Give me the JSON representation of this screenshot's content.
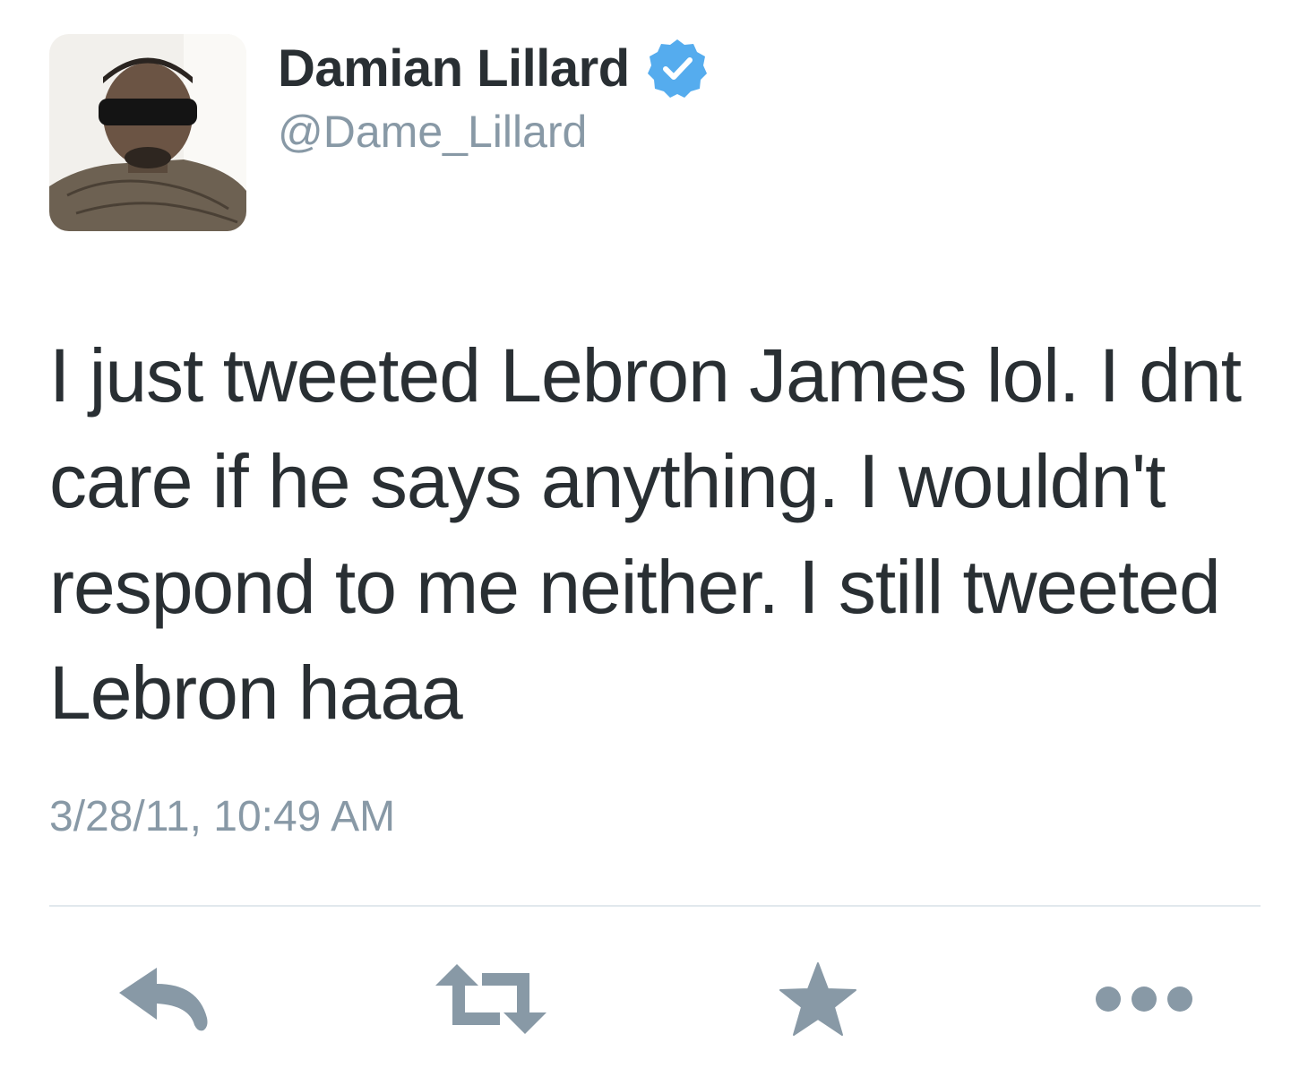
{
  "tweet": {
    "display_name": "Damian Lillard",
    "handle": "@Dame_Lillard",
    "verified": true,
    "text": "I just tweeted Lebron James lol. I dnt care if he says anything. I wouldn't respond to me neither. I still tweeted Lebron haaa",
    "timestamp": "3/28/11, 10:49 AM"
  },
  "actions": [
    {
      "name": "reply",
      "icon": "reply-icon"
    },
    {
      "name": "retweet",
      "icon": "retweet-icon"
    },
    {
      "name": "favorite",
      "icon": "star-icon"
    },
    {
      "name": "more",
      "icon": "more-dots-icon"
    }
  ],
  "colors": {
    "text": "#292f33",
    "secondary": "#8899a6",
    "verified_badge": "#55acee",
    "divider": "#e1e8ed"
  }
}
